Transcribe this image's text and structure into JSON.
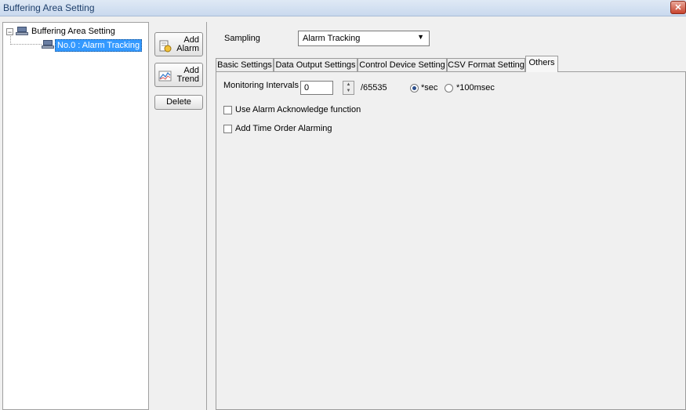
{
  "window": {
    "title": "Buffering Area Setting",
    "close_glyph": "✕"
  },
  "tree": {
    "root": {
      "label": "Buffering Area Setting",
      "expander": "−",
      "icon": "device-icon"
    },
    "child": {
      "label": "No.0 : Alarm Tracking",
      "icon": "device-icon"
    }
  },
  "toolbar": {
    "add_alarm": {
      "line1": "Add",
      "line2": "Alarm",
      "icon": "add-alarm-icon"
    },
    "add_trend": {
      "line1": "Add",
      "line2": "Trend",
      "icon": "add-trend-icon"
    },
    "delete_label": "Delete"
  },
  "sampling": {
    "label": "Sampling",
    "value": "Alarm Tracking",
    "arrow": "▼"
  },
  "tabs": [
    "Basic Settings",
    "Data Output Settings",
    "Control Device Setting",
    "CSV Format Setting",
    "Others"
  ],
  "active_tab": "Others",
  "others": {
    "monitoring_label": "Monitoring Intervals",
    "monitoring_value": "0",
    "max_suffix": "/65535",
    "unit_sec": "*sec",
    "unit_100ms": "*100msec",
    "selected_unit": "sec",
    "use_alarm_ack_label": "Use Alarm Acknowledge function",
    "use_alarm_ack_checked": false,
    "add_time_order_label": "Add Time Order Alarming",
    "add_time_order_checked": false
  },
  "colors": {
    "selection": "#3399ff",
    "close": "#c8432d"
  }
}
